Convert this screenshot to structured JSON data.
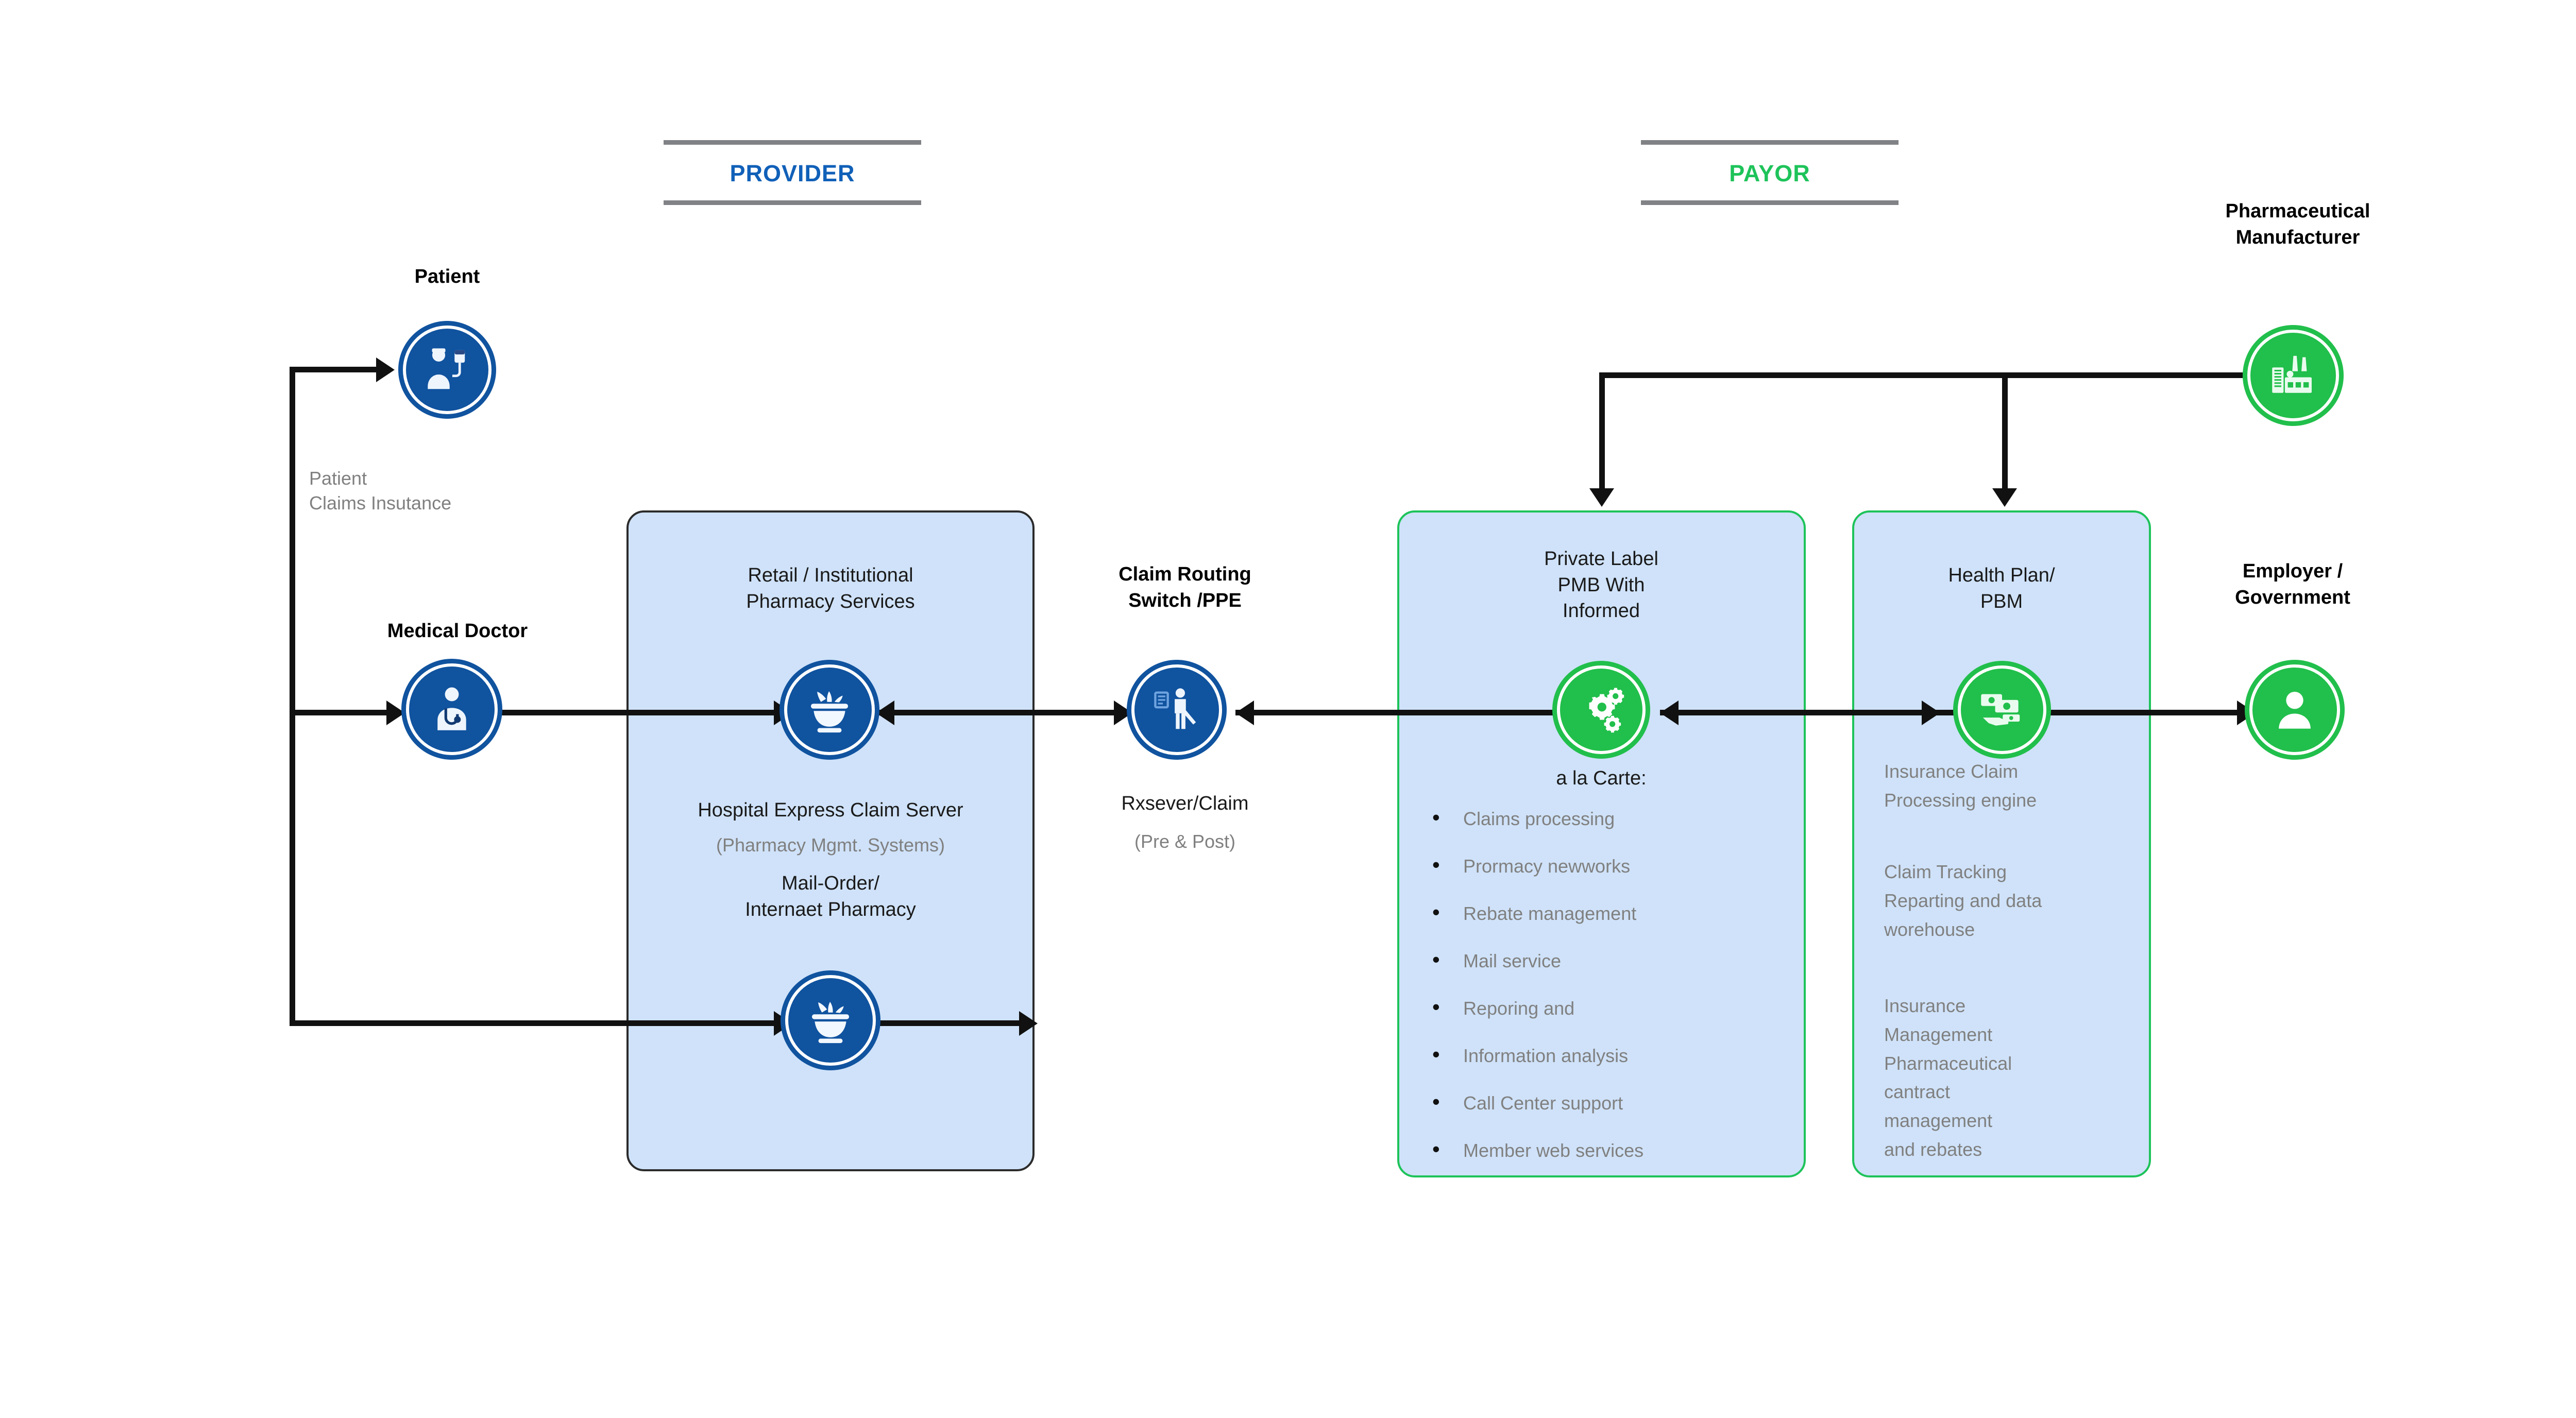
{
  "diagram": {
    "sections": [
      {
        "id": "provider",
        "label": "PROVIDER",
        "color": "#1060b8"
      },
      {
        "id": "payor",
        "label": "PAYOR",
        "color": "#1ec35a"
      }
    ],
    "nodes": {
      "patient": {
        "title": "Patient",
        "sub": "Patient\nClaims Insutance",
        "icon": "patient-icon",
        "color": "#10539f"
      },
      "medical_doctor": {
        "title": "Medical Doctor",
        "icon": "doctor-icon",
        "color": "#10539f"
      },
      "retail_pharmacy": {
        "title": "Retail / Institutional\nPharmacy Services",
        "sub_bold": "Hospital Express Claim Server",
        "sub_muted": "(Pharmacy Mgmt. Systems)",
        "sub2": "Mail-Order/\nInternaet Pharmacy",
        "icon": "mortar-pestle-icon",
        "color": "#10539f"
      },
      "mail_order_pharmacy": {
        "icon": "mortar-pestle-icon",
        "color": "#10539f"
      },
      "claim_routing_switch": {
        "title": "Claim Routing\nSwitch /PPE",
        "sub_bold": "Rxsever/Claim",
        "sub_muted": "(Pre & Post)",
        "icon": "ppe-worker-icon",
        "color": "#10539f"
      },
      "private_label_pmb": {
        "title": "Private Label\nPMB With\nInformed",
        "sub_bold": "a la Carte:",
        "icon": "gears-icon",
        "color": "#21bf4b",
        "bullets": [
          "Claims processing",
          "Prormacy newworks",
          "Rebate management",
          "Mail service",
          "Reporing and",
          "Information analysis",
          "Call Center support",
          "Member web services"
        ]
      },
      "health_plan_pbm": {
        "title": "Health Plan/\nPBM",
        "icon": "money-hand-icon",
        "color": "#21bf4b",
        "paragraphs": [
          "Insurance Claim\nProcessing engine",
          "Claim Tracking\nReparting and data\nworehouse",
          "Insurance\nManagement\nPharmaceutical\ncantract\nmanagement\nand rebates"
        ]
      },
      "pharmaceutical_manufacturer": {
        "title": "Pharmaceutical\nManufacturer",
        "icon": "factory-icon",
        "color": "#21bf4b"
      },
      "employer_government": {
        "title": "Employer /\nGovernment",
        "icon": "person-icon",
        "color": "#21bf4b"
      }
    },
    "colors": {
      "box_fill": "#cfe2f9",
      "box_border_dark": "#2b2b2b",
      "box_border_green": "#1ec35a",
      "rule": "#808285",
      "connector": "#111111",
      "muted_text": "#808080"
    }
  }
}
